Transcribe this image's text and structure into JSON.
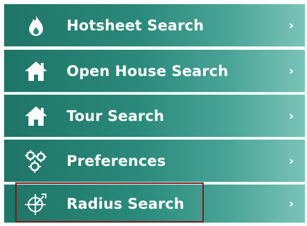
{
  "menu": {
    "items": [
      {
        "label": "Hotsheet Search",
        "icon": "flame-icon",
        "chevron": "›"
      },
      {
        "label": "Open House Search",
        "icon": "house-icon",
        "chevron": "›"
      },
      {
        "label": "Tour Search",
        "icon": "house-icon",
        "chevron": "›"
      },
      {
        "label": "Preferences",
        "icon": "gears-icon",
        "chevron": "›"
      },
      {
        "label": "Radius Search",
        "icon": "crosshair-icon",
        "chevron": "›"
      }
    ],
    "selected_index": 4
  },
  "colors": {
    "item_gradient_start": "#1f7567",
    "item_gradient_end": "#7ac4b8",
    "text": "#ffffff",
    "selected_outline": "#7a1a1a"
  }
}
